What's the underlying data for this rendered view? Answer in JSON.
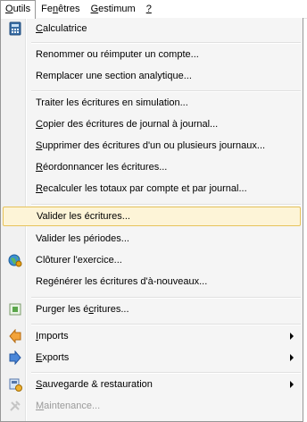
{
  "menubar": {
    "items": [
      {
        "name": "menu-outils",
        "mnemonic": "O",
        "rest": "utils"
      },
      {
        "name": "menu-fenetres",
        "pre": "Fe",
        "mnemonic": "n",
        "rest": "êtres"
      },
      {
        "name": "menu-gestimum",
        "mnemonic": "G",
        "rest": "estimum"
      },
      {
        "name": "menu-help",
        "mnemonic": "?",
        "rest": ""
      }
    ]
  },
  "menu": {
    "items": [
      {
        "pre": "",
        "mn": "C",
        "post": "alculatrice",
        "icon": "calculator-icon"
      },
      {
        "pre": "Renommer ou réimputer un compte...",
        "mn": "",
        "post": ""
      },
      {
        "pre": "Remplacer une section analytique...",
        "mn": "",
        "post": ""
      },
      {
        "pre": "Traiter les écritures en simulation...",
        "mn": "",
        "post": ""
      },
      {
        "pre": "",
        "mn": "C",
        "post": "opier des écritures de journal à journal..."
      },
      {
        "pre": "",
        "mn": "S",
        "post": "upprimer des écritures d'un ou plusieurs journaux..."
      },
      {
        "pre": "",
        "mn": "R",
        "post": "éordonnancer les écritures..."
      },
      {
        "pre": "",
        "mn": "R",
        "post": "ecalculer les totaux par compte et par journal..."
      },
      {
        "pre": "Valider les écritures...",
        "mn": "",
        "post": ""
      },
      {
        "pre": "Valider les périodes...",
        "mn": "",
        "post": ""
      },
      {
        "pre": "Clôturer l'exercice...",
        "mn": "",
        "post": "",
        "icon": "globe-close-year-icon"
      },
      {
        "pre": "Regénérer les écritures d'à-nouveaux...",
        "mn": "",
        "post": ""
      },
      {
        "pre": "Purger les é",
        "mn": "c",
        "post": "ritures...",
        "icon": "purge-icon"
      },
      {
        "pre": "",
        "mn": "I",
        "post": "mports",
        "icon": "import-icon"
      },
      {
        "pre": "",
        "mn": "E",
        "post": "xports",
        "icon": "export-icon"
      },
      {
        "pre": "",
        "mn": "S",
        "post": "auvegarde & restauration",
        "icon": "backup-icon"
      },
      {
        "pre": "",
        "mn": "M",
        "post": "aintenance...",
        "icon": "maintenance-icon"
      }
    ]
  }
}
